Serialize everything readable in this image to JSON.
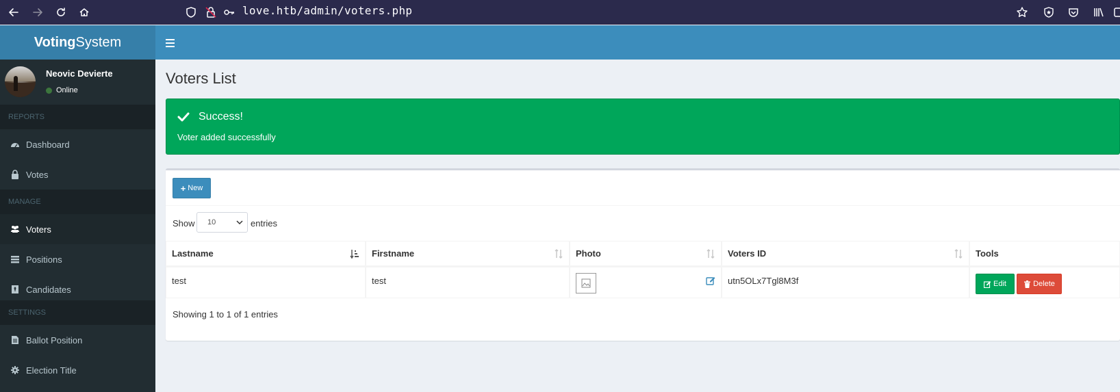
{
  "browser": {
    "url": "love.htb/admin/voters.php"
  },
  "app": {
    "logo_bold": "Voting",
    "logo_rest": "System"
  },
  "user": {
    "name": "Neovic Devierte",
    "status": "Online"
  },
  "sidebar": {
    "sections": [
      {
        "header": "REPORTS",
        "items": [
          {
            "label": "Dashboard",
            "icon": "dashboard-icon"
          },
          {
            "label": "Votes",
            "icon": "lock-icon"
          }
        ]
      },
      {
        "header": "MANAGE",
        "items": [
          {
            "label": "Voters",
            "icon": "users-icon",
            "active": true
          },
          {
            "label": "Positions",
            "icon": "tasks-icon"
          },
          {
            "label": "Candidates",
            "icon": "black-tie-icon"
          }
        ]
      },
      {
        "header": "SETTINGS",
        "items": [
          {
            "label": "Ballot Position",
            "icon": "file-text-icon"
          },
          {
            "label": "Election Title",
            "icon": "cog-icon"
          }
        ]
      }
    ]
  },
  "page": {
    "title": "Voters List"
  },
  "alert": {
    "title": "Success!",
    "message": "Voter added successfully",
    "color": "#00a65a"
  },
  "toolbar": {
    "new_label": "New"
  },
  "datatable": {
    "show_label": "Show",
    "page_size": "10",
    "entries_label": "entries",
    "columns": [
      "Lastname",
      "Firstname",
      "Photo",
      "Voters ID",
      "Tools"
    ],
    "rows": [
      {
        "lastname": "test",
        "firstname": "test",
        "voters_id": "utn5OLx7Tgl8M3f"
      }
    ],
    "edit_label": "Edit",
    "delete_label": "Delete",
    "info": "Showing 1 to 1 of 1 entries"
  }
}
